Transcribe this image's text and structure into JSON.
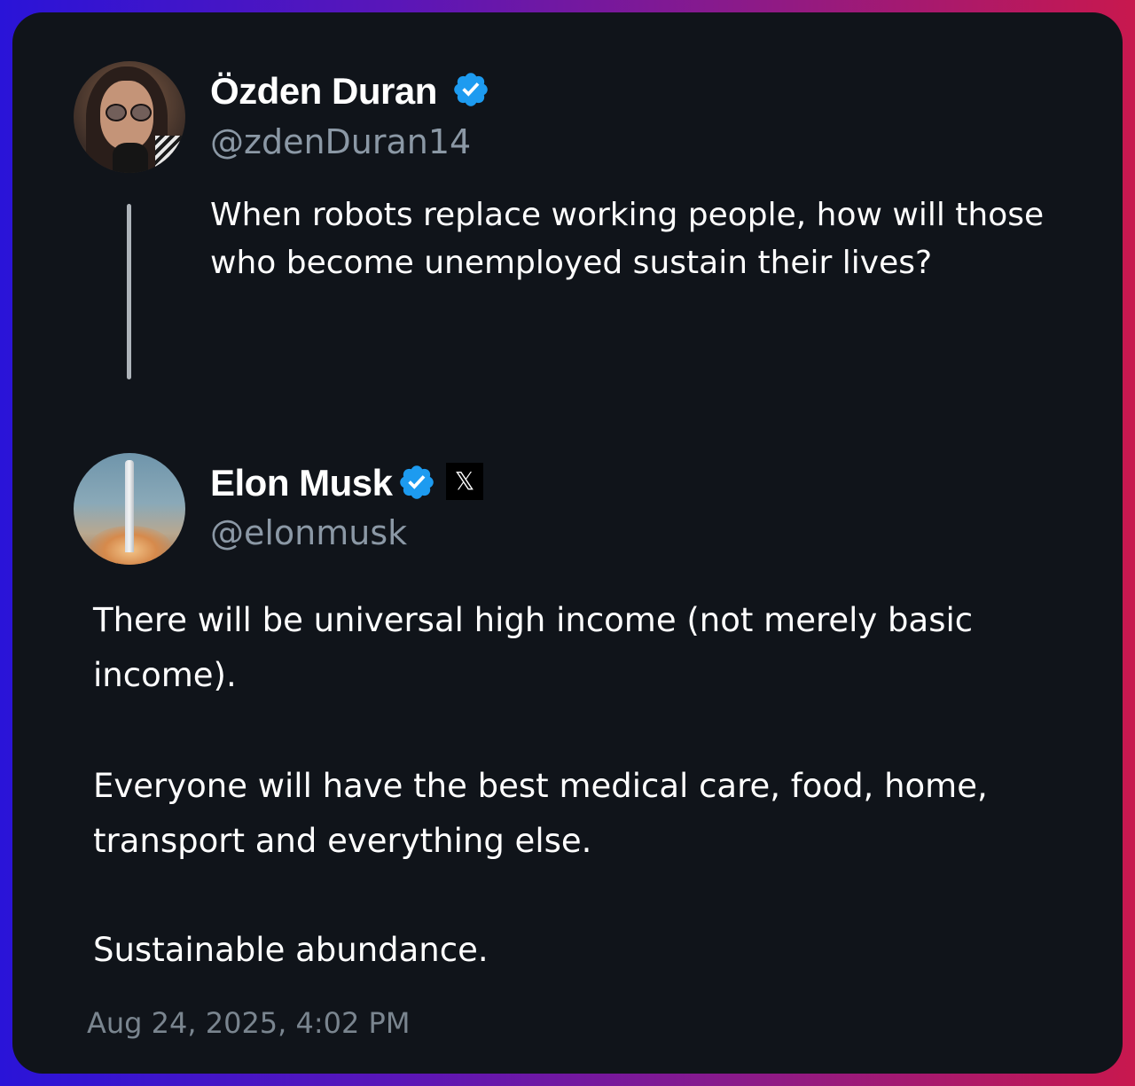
{
  "quoted_post": {
    "author_name": "Özden Duran",
    "handle": "@zdenDuran14",
    "text": "When robots replace working people, how will those who become unemployed sustain their lives?",
    "avatar_icon": "profile-photo-woman-sunglasses",
    "verified_icon": "verified-badge-icon"
  },
  "reply_post": {
    "author_name": "Elon Musk",
    "handle": "@elonmusk",
    "paragraphs": [
      "There will be universal high income (not merely basic income).",
      "Everyone will have the best medical care, food, home, transport and everything else.",
      "Sustainable abundance."
    ],
    "timestamp": "Aug 24, 2025, 4:02 PM",
    "avatar_icon": "profile-photo-rocket-launch",
    "verified_icon": "verified-badge-icon",
    "affiliate_badge_icon": "x-logo-icon",
    "affiliate_badge_glyph": "𝕏"
  },
  "colors": {
    "card_background": "#10141a",
    "primary_text": "#ffffff",
    "secondary_text": "#8b98a5",
    "verified_blue": "#1d9bf0",
    "thread_line": "#aeb4ba",
    "frame_gradient_start": "#2a14d8",
    "frame_gradient_end": "#c8184e"
  }
}
